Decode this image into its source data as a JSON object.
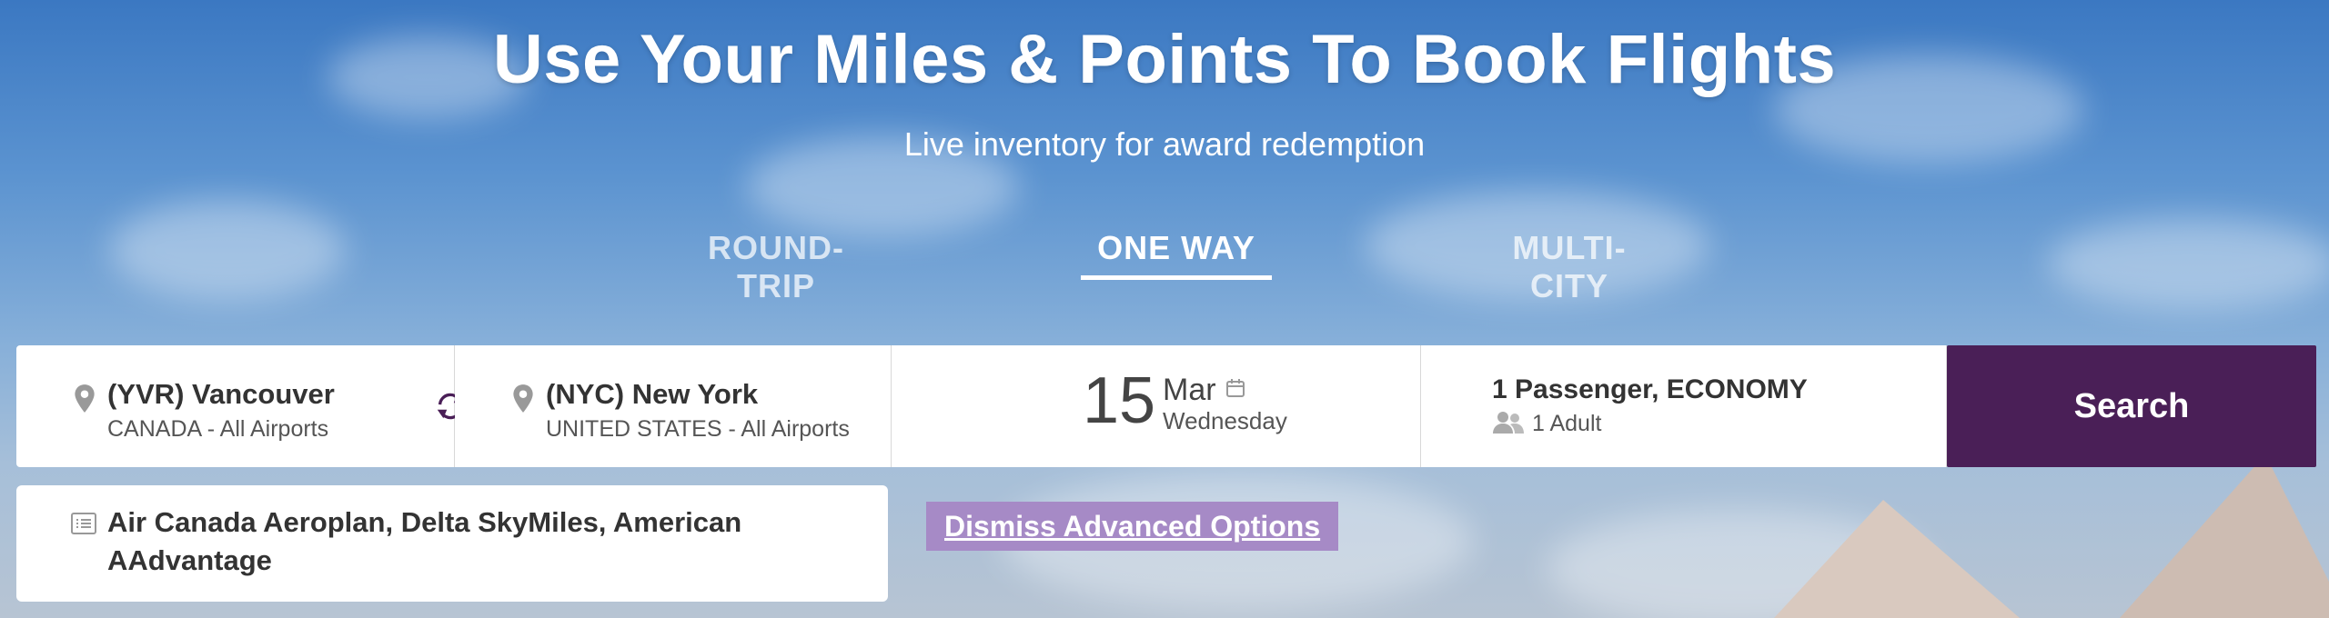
{
  "hero": {
    "title": "Use Your Miles & Points To Book Flights",
    "subtitle": "Live inventory for award redemption"
  },
  "trip_tabs": [
    {
      "label": "ROUND-TRIP",
      "active": false
    },
    {
      "label": "ONE WAY",
      "active": true
    },
    {
      "label": "MULTI-CITY",
      "active": false
    }
  ],
  "origin": {
    "city": "(YVR) Vancouver",
    "detail": "CANADA - All Airports",
    "icon": "location-pin-icon"
  },
  "destination": {
    "city": "(NYC) New York",
    "detail": "UNITED STATES - All Airports",
    "icon": "location-pin-icon"
  },
  "swap_icon": "swap-arrows-icon",
  "date": {
    "day": "15",
    "month": "Mar",
    "weekday": "Wednesday",
    "icon": "calendar-icon"
  },
  "passengers": {
    "summary": "1 Passenger, ECONOMY",
    "detail": "1 Adult",
    "icon": "people-icon"
  },
  "search": {
    "label": "Search"
  },
  "programs": {
    "text": "Air Canada Aeroplan, Delta SkyMiles, American AAdvantage",
    "icon": "list-icon"
  },
  "advanced": {
    "dismiss_label": "Dismiss Advanced Options"
  },
  "colors": {
    "accent": "#4a1f57",
    "dismiss_bg": "#a68ac6"
  }
}
